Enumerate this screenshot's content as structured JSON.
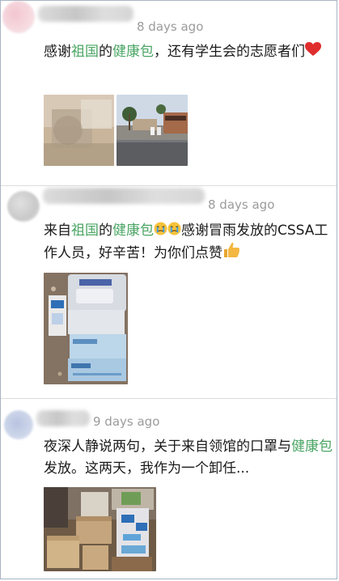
{
  "posts": [
    {
      "time": "8 days ago",
      "text_parts": [
        "感谢",
        "祖国",
        "的",
        "健康包",
        "，还有学生会的志愿者们"
      ],
      "emojis": [
        "heart-emoji"
      ],
      "photos": [
        "blurred-health-pack-photo",
        "street-photo"
      ]
    },
    {
      "time": "8 days ago",
      "text_parts": [
        "来自",
        "祖国",
        "的",
        "健康包",
        "感谢冒雨发放的CSSA工作人员，好辛苦！为你们点赞"
      ],
      "emojis": [
        "crying-face-emoji",
        "crying-face-emoji",
        "thumbs-up-emoji"
      ],
      "photos": [
        "masks-wipes-photo"
      ]
    },
    {
      "time": "9 days ago",
      "text_parts": [
        "夜深人静说两句，关于来自领馆的口罩与",
        "健康包",
        "发放。这两天，我作为一个卸任..."
      ],
      "emojis": [],
      "photos": [
        "boxes-room-photo"
      ]
    }
  ],
  "colors": {
    "link_green": "#4aa564",
    "timestamp_gray": "#9b9b9b",
    "divider": "#dcdcdc",
    "frame_border": "#a8b4c2"
  }
}
